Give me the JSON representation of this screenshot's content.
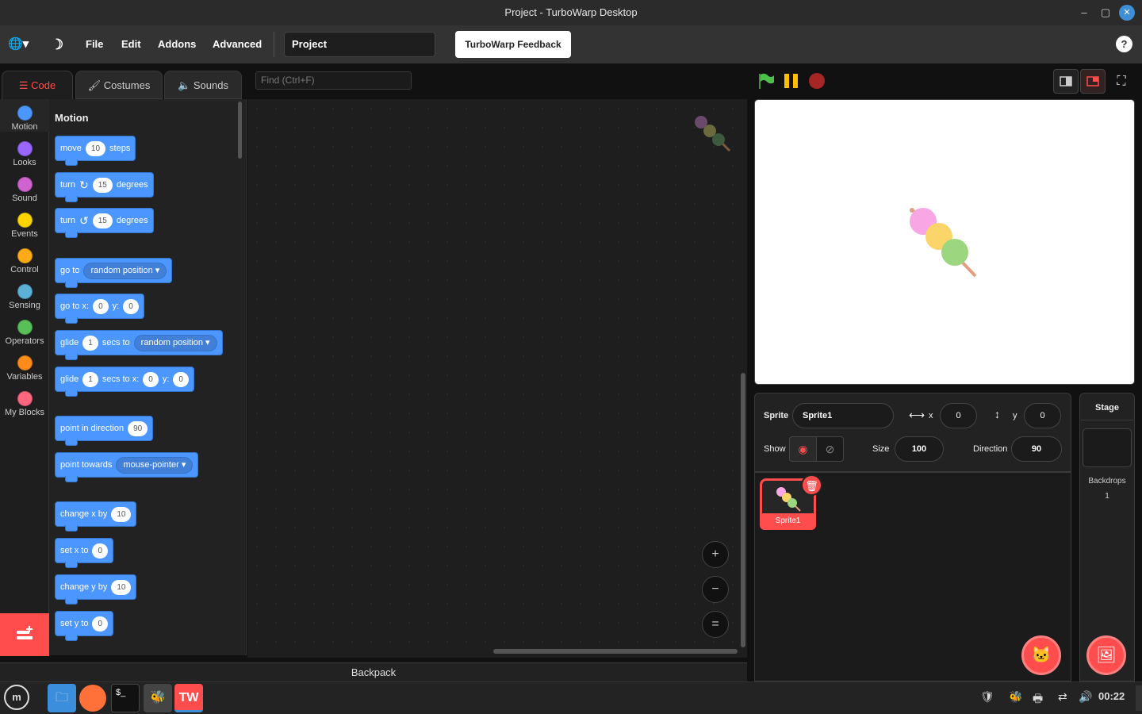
{
  "window": {
    "title": "Project - TurboWarp Desktop",
    "minimize": "–",
    "maximize": "▢",
    "close": "✕"
  },
  "menu": {
    "language_icon": "🌐▾",
    "theme_icon": "☽",
    "file": "File",
    "edit": "Edit",
    "addons": "Addons",
    "advanced": "Advanced",
    "project_title": "Project",
    "feedback": "TurboWarp Feedback",
    "help": "?"
  },
  "tabs": {
    "code": "Code",
    "costumes": "Costumes",
    "sounds": "Sounds"
  },
  "find": {
    "placeholder": "Find (Ctrl+F)"
  },
  "categories": [
    {
      "label": "Motion",
      "color": "#4c97ff"
    },
    {
      "label": "Looks",
      "color": "#9966ff"
    },
    {
      "label": "Sound",
      "color": "#cf63cf"
    },
    {
      "label": "Events",
      "color": "#ffd500"
    },
    {
      "label": "Control",
      "color": "#ffab19"
    },
    {
      "label": "Sensing",
      "color": "#5cb1d6"
    },
    {
      "label": "Operators",
      "color": "#59c059"
    },
    {
      "label": "Variables",
      "color": "#ff8c1a"
    },
    {
      "label": "My Blocks",
      "color": "#ff6680"
    }
  ],
  "palette": {
    "heading": "Motion",
    "move": {
      "a": "move",
      "v": "10",
      "b": "steps"
    },
    "turn_right": {
      "a": "turn",
      "icon": "↻",
      "v": "15",
      "b": "degrees"
    },
    "turn_left": {
      "a": "turn",
      "icon": "↺",
      "v": "15",
      "b": "degrees"
    },
    "go_to": {
      "a": "go to",
      "opt": "random position"
    },
    "go_to_xy": {
      "a": "go to x:",
      "x": "0",
      "b": "y:",
      "y": "0"
    },
    "glide_to": {
      "a": "glide",
      "v": "1",
      "b": "secs to",
      "opt": "random position"
    },
    "glide_xy": {
      "a": "glide",
      "v": "1",
      "b": "secs to x:",
      "x": "0",
      "c": "y:",
      "y": "0"
    },
    "point_dir": {
      "a": "point in direction",
      "v": "90"
    },
    "point_towards": {
      "a": "point towards",
      "opt": "mouse-pointer"
    },
    "change_x": {
      "a": "change x by",
      "v": "10"
    },
    "set_x": {
      "a": "set x to",
      "v": "0"
    },
    "change_y": {
      "a": "change y by",
      "v": "10"
    },
    "set_y": {
      "a": "set y to",
      "v": "0"
    }
  },
  "workspace": {
    "zoom_in": "+",
    "zoom_out": "−",
    "reset": "="
  },
  "backpack": "Backpack",
  "sprite_info": {
    "sprite_label": "Sprite",
    "sprite_name": "Sprite1",
    "x_label": "x",
    "x": "0",
    "y_label": "y",
    "y": "0",
    "show_label": "Show",
    "size_label": "Size",
    "size": "100",
    "direction_label": "Direction",
    "direction": "90"
  },
  "sprites": [
    {
      "name": "Sprite1",
      "selected": true
    }
  ],
  "stage_panel": {
    "title": "Stage",
    "backdrops_label": "Backdrops",
    "backdrops_count": "1"
  },
  "taskbar": {
    "clock": "00:22"
  }
}
